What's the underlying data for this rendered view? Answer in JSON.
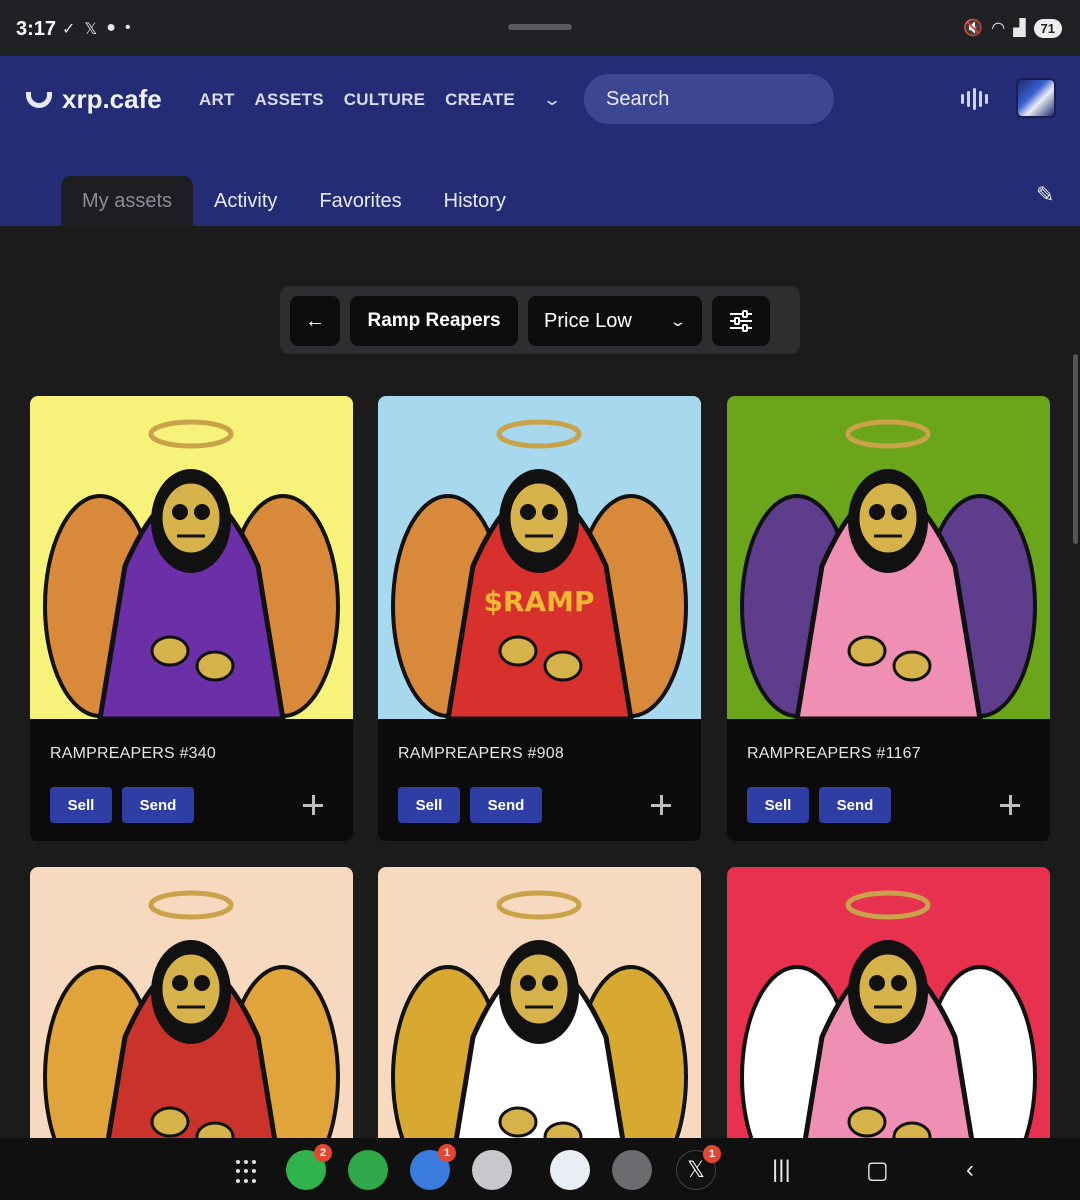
{
  "status_bar": {
    "time": "3:17",
    "left_icons": [
      "✓̲",
      "𝕏",
      "●",
      "•"
    ],
    "battery": "71",
    "right_icons": [
      "🔇",
      "wifi",
      "signal"
    ]
  },
  "header": {
    "logo_text": "xrp.cafe",
    "nav": [
      "ART",
      "ASSETS",
      "CULTURE",
      "CREATE"
    ],
    "search_placeholder": "Search"
  },
  "tabs": [
    "My assets",
    "Activity",
    "Favorites",
    "History"
  ],
  "active_tab": "My assets",
  "toolbar": {
    "back_symbol": "←",
    "collection": "Ramp Reapers",
    "sort": "Price Low",
    "sort_chevron": "⌄"
  },
  "cards": [
    {
      "title": "RAMPREAPERS #340",
      "sell": "Sell",
      "send": "Send",
      "bg": "#f7f27a",
      "robe": "#6b2fa8",
      "wings": "#d9893a"
    },
    {
      "title": "RAMPREAPERS #908",
      "sell": "Sell",
      "send": "Send",
      "bg": "#a7d8ee",
      "robe": "#d8302c",
      "wings": "#d9893a",
      "robe_text": "$RAMP"
    },
    {
      "title": "RAMPREAPERS #1167",
      "sell": "Sell",
      "send": "Send",
      "bg": "#6aa51a",
      "robe": "#f08fb4",
      "wings": "#5e3d8c"
    },
    {
      "title": "",
      "sell": "",
      "send": "",
      "bg": "#f7d9bf",
      "robe": "#c9332c",
      "wings": "#e0a43a"
    },
    {
      "title": "",
      "sell": "",
      "send": "",
      "bg": "#f7d9bf",
      "robe": "#ffffff",
      "wings": "#d7a931"
    },
    {
      "title": "",
      "sell": "",
      "send": "",
      "bg": "#e8304f",
      "robe": "#f08fb4",
      "wings": "#ffffff"
    }
  ],
  "dock": {
    "badges": {
      "phone": "2",
      "messages": "1",
      "x": "1"
    }
  }
}
